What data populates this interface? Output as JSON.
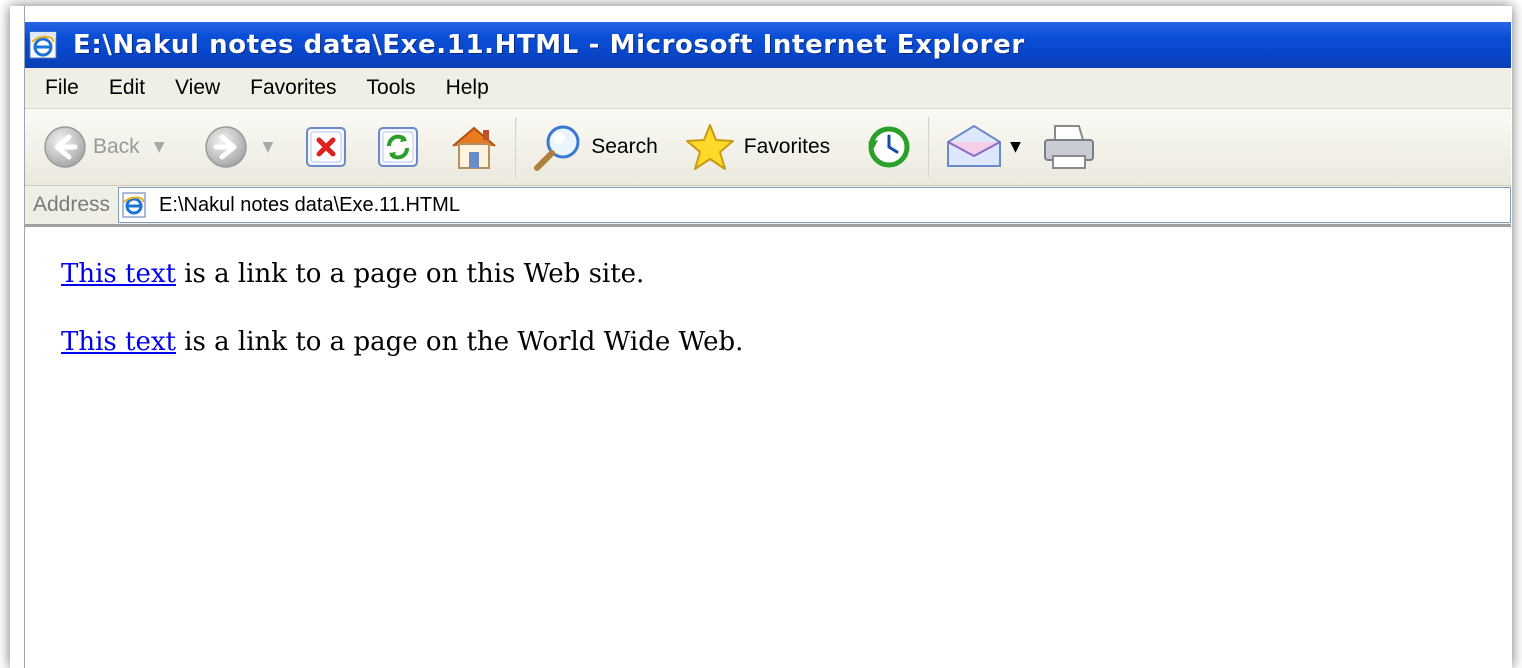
{
  "window": {
    "title": "E:\\Nakul notes data\\Exe.11.HTML - Microsoft Internet Explorer",
    "title_bar_color": "#0b4fd8"
  },
  "menu": {
    "items": [
      "File",
      "Edit",
      "View",
      "Favorites",
      "Tools",
      "Help"
    ]
  },
  "toolbar": {
    "back_label": "Back",
    "search_label": "Search",
    "favorites_label": "Favorites",
    "icons": [
      "back-arrow-icon",
      "forward-arrow-icon",
      "stop-icon",
      "refresh-icon",
      "home-icon",
      "search-icon",
      "favorites-star-icon",
      "history-icon",
      "mail-icon",
      "print-icon"
    ]
  },
  "address": {
    "label": "Address",
    "value": "E:\\Nakul notes data\\Exe.11.HTML"
  },
  "content": {
    "paragraphs": [
      {
        "link_text": "This text",
        "rest": " is a link to a page on this Web site."
      },
      {
        "link_text": "This text",
        "rest": " is a link to a page on the World Wide Web."
      }
    ],
    "link_color": "#0000ee"
  }
}
